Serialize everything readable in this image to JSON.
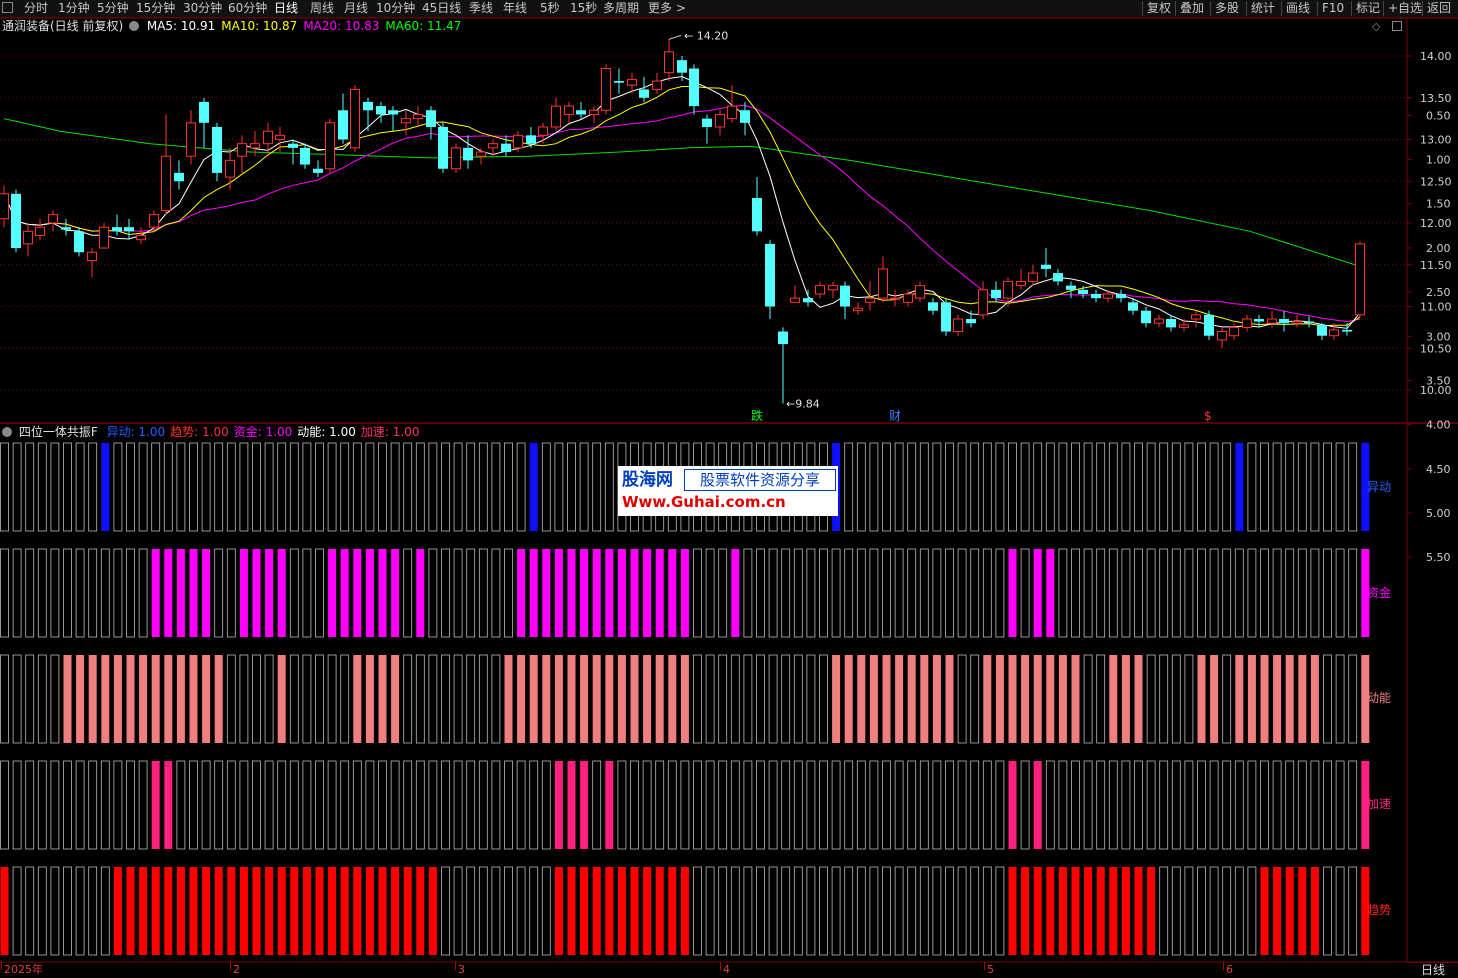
{
  "toolbar": {
    "periods": [
      "分时",
      "1分钟",
      "5分钟",
      "15分钟",
      "30分钟",
      "60分钟",
      "日线",
      "周线",
      "月线",
      "10分钟",
      "45日线",
      "季线",
      "年线",
      "5秒",
      "15秒",
      "多周期",
      "更多 >"
    ],
    "active_period": "日线",
    "tools": [
      "复权",
      "叠加",
      "多股",
      "统计",
      "画线",
      "F10",
      "标记",
      "+自选",
      "返回"
    ]
  },
  "main_chart": {
    "title": "通润装备(日线 前复权)",
    "ma": [
      {
        "label": "MA5: 10.91",
        "color": "#ffffff"
      },
      {
        "label": "MA10: 10.87",
        "color": "#ffff00"
      },
      {
        "label": "MA20: 10.83",
        "color": "#ff00ff"
      },
      {
        "label": "MA60: 11.47",
        "color": "#00ff00"
      }
    ],
    "high_label": "14.20",
    "low_label": "9.84",
    "markers": [
      {
        "text": "跌",
        "color": "#00ff00"
      },
      {
        "text": "财",
        "color": "#4080ff"
      },
      {
        "text": "$",
        "color": "#ff3030"
      }
    ],
    "y_ticks": [
      "14.00",
      "13.50",
      "13.00",
      "12.50",
      "12.00",
      "11.50",
      "11.00",
      "10.50",
      "10.00"
    ]
  },
  "indicator": {
    "title": "四位一体共振F",
    "params": [
      {
        "label": "异动: 1.00",
        "color": "#2060ff"
      },
      {
        "label": "趋势: 1.00",
        "color": "#ff3030"
      },
      {
        "label": "资金: 1.00",
        "color": "#ff00ff"
      },
      {
        "label": "动能: 1.00",
        "color": "#ffffff"
      },
      {
        "label": "加速: 1.00",
        "color": "#ff3060"
      }
    ],
    "y_ticks": [
      "5.50",
      "5.00",
      "4.50",
      "4.00",
      "3.50",
      "3.00",
      "2.50",
      "2.00",
      "1.50",
      "1.00",
      "0.50"
    ],
    "row_tags": [
      {
        "text": "异动",
        "color": "#2060ff"
      },
      {
        "text": "资金",
        "color": "#ff00ff"
      },
      {
        "text": "动能",
        "color": "#f08080"
      },
      {
        "text": "加速",
        "color": "#ff2080"
      },
      {
        "text": "趋势",
        "color": "#ff2020"
      }
    ]
  },
  "date_axis": {
    "labels": [
      "2025年",
      "2",
      "3",
      "4",
      "5",
      "6"
    ],
    "period_tab": "日线"
  },
  "watermark": {
    "line1_brand": "股海网",
    "line1_text": "股票软件资源分享",
    "line2": "Www.Guhai.com.cn"
  },
  "colors": {
    "up": "#ff3333",
    "down": "#54ffff",
    "panel_border": "#7a0000",
    "grid": "#7a0000"
  }
}
